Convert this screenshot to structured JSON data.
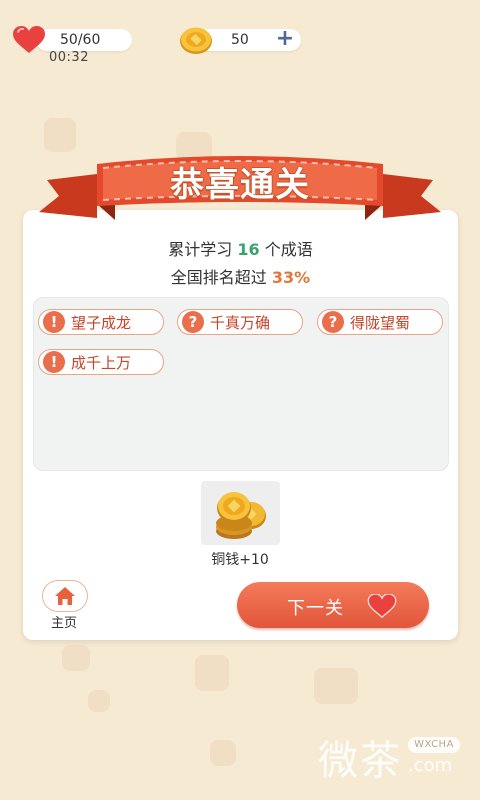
{
  "hud": {
    "lives": "50/60",
    "timer": "00:32",
    "coins": "50",
    "add_coins_symbol": "+"
  },
  "banner": {
    "title": "恭喜通关"
  },
  "stats": {
    "learned_prefix": "累计学习",
    "learned_count": "16",
    "learned_suffix": "个成语",
    "rank_prefix": "全国排名超过",
    "rank_percent": "33%"
  },
  "idioms": [
    {
      "icon": "!",
      "text": "望子成龙"
    },
    {
      "icon": "?",
      "text": "千真万确"
    },
    {
      "icon": "?",
      "text": "得陇望蜀"
    },
    {
      "icon": "!",
      "text": "成千上万"
    }
  ],
  "reward": {
    "label": "铜钱+10"
  },
  "buttons": {
    "home": "主页",
    "next": "下一关"
  },
  "watermark": {
    "logo": "微茶",
    "badge": "WXCHA",
    "domain": ".com"
  },
  "colors": {
    "background": "#f6ead2",
    "accent": "#e2553a",
    "green": "#3aa36b",
    "orange": "#e0773c"
  }
}
